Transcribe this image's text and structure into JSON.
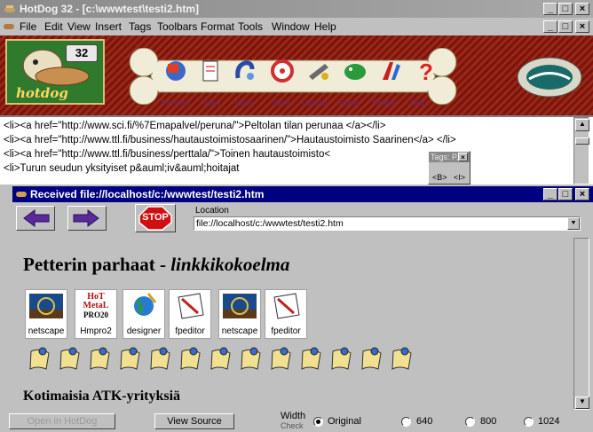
{
  "app": {
    "title": "HotDog 32 - [c:\\wwwtest\\testi2.htm]",
    "caption_buttons": [
      "_",
      "□",
      "×"
    ]
  },
  "menu": [
    "File",
    "Edit",
    "View",
    "Insert",
    "Tags",
    "Toolbars",
    "Format",
    "Tools",
    "Window",
    "Help"
  ],
  "logo": {
    "badge": "32",
    "word": "hotdog"
  },
  "toolbar_labels": [
    "Preview",
    "New",
    "Open",
    "Save",
    "Upload",
    "Rover",
    "Toolbar",
    "Help"
  ],
  "editor_lines": [
    "<li><a href=\"http://www.sci.fi/%7Emapalvel/peruna/\">Peltolan tilan perunaa </a></li>",
    "<li><a href=\"http://www.ttl.fi/business/hautaustoimistosaarinen/\">Hautaustoimisto Saarinen</a> </li>",
    "<li><a href=\"http://www.ttl.fi/business/perttala/\">Toinen hautaustoimisto<",
    "<li>Turun seudun yksityiset p&auml;iv&auml;hoitajat"
  ],
  "tags_palette": {
    "title": "Tags: P...",
    "items": [
      "<B>",
      "<I>"
    ]
  },
  "browser": {
    "title": "Received file://localhost/c:/wwwtest/testi2.htm",
    "stop_label": "STOP",
    "location_label": "Location",
    "location_value": "file://localhost/c:/wwwtest/testi2.htm",
    "heading_plain": "Petterin parhaat - ",
    "heading_italic": "linkkikokoelma",
    "link_tiles": [
      "netscape",
      "Hmpro2",
      "designer",
      "fpeditor",
      "netscape",
      "fpeditor"
    ],
    "hotmetal_logo_lines": [
      "HoT",
      "MetaL",
      "PRO20"
    ],
    "subheading": "Kotimaisia ATK-yrityksiä"
  },
  "statusbar": {
    "open_in_hotdog": "Open in HotDog",
    "view_source": "View Source",
    "width_label": "Width",
    "width_label2": "Check",
    "options": [
      "Original",
      "640",
      "800",
      "1024"
    ],
    "selected": "Original"
  },
  "colors": {
    "browser_title_bg": "#000080",
    "banner_bg": "#8a1c10",
    "stop_red": "#d01010"
  }
}
